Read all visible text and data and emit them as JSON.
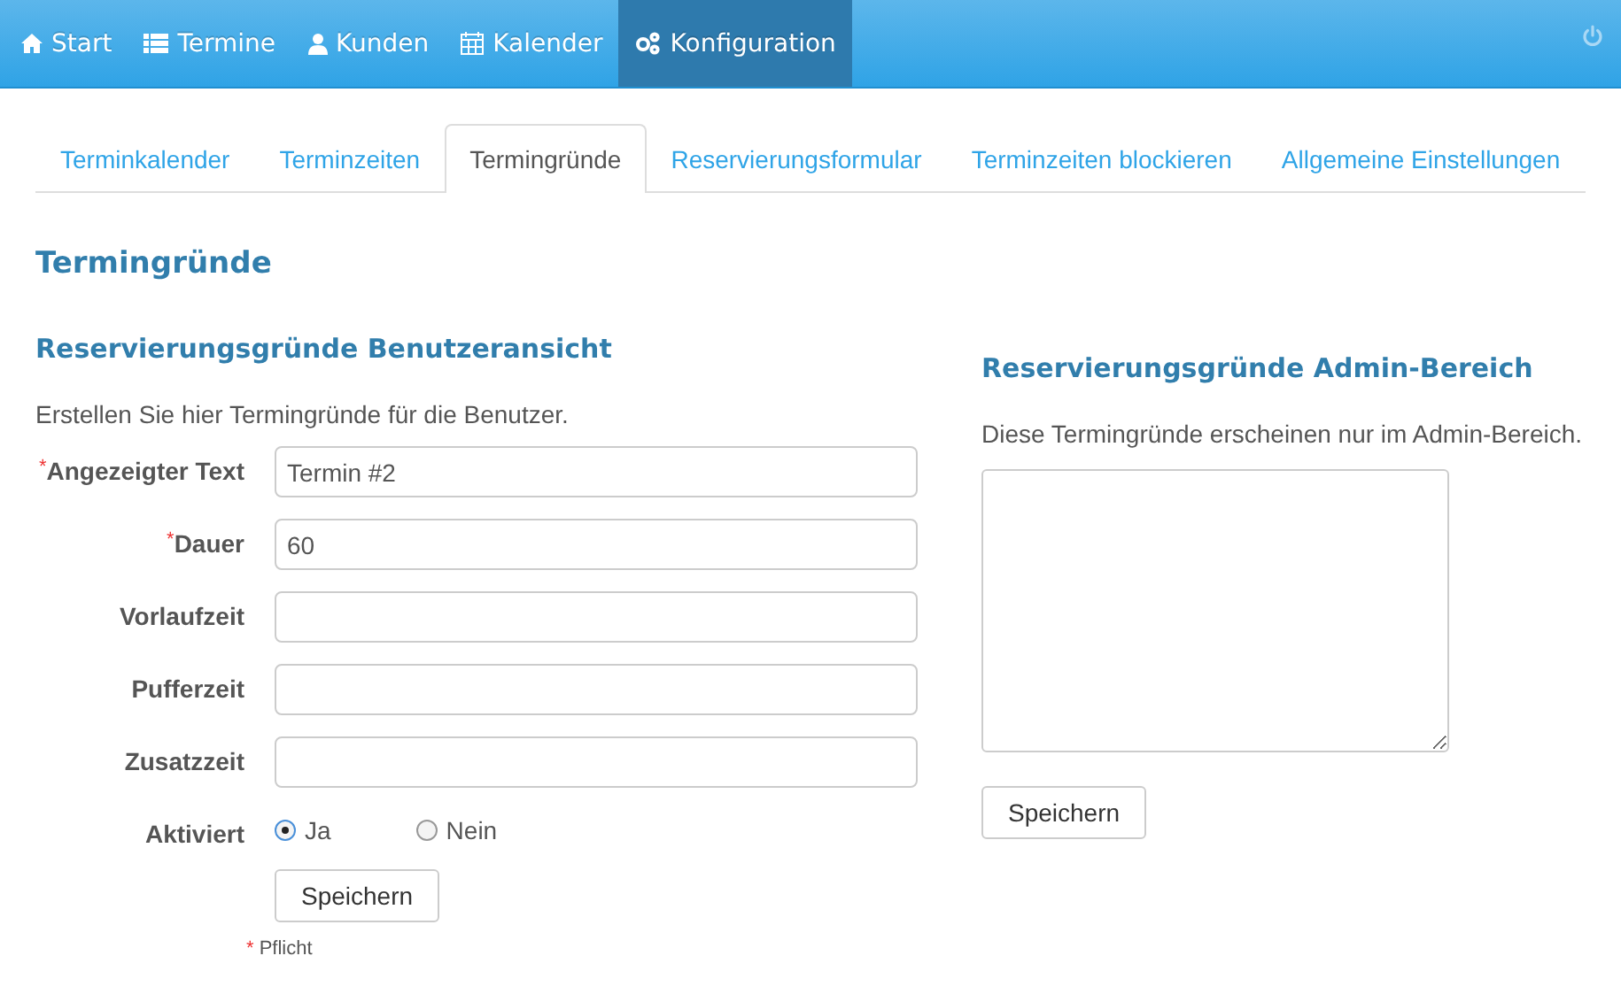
{
  "navbar": {
    "items": [
      {
        "label": "Start",
        "selected": false
      },
      {
        "label": "Termine",
        "selected": false
      },
      {
        "label": "Kunden",
        "selected": false
      },
      {
        "label": "Kalender",
        "selected": false
      },
      {
        "label": "Konfiguration",
        "selected": true
      }
    ]
  },
  "tabs": [
    {
      "label": "Terminkalender",
      "selected": false
    },
    {
      "label": "Terminzeiten",
      "selected": false
    },
    {
      "label": "Termingründe",
      "selected": true
    },
    {
      "label": "Reservierungsformular",
      "selected": false
    },
    {
      "label": "Terminzeiten blockieren",
      "selected": false
    },
    {
      "label": "Allgemeine Einstellungen",
      "selected": false
    }
  ],
  "page_title": "Termingründe",
  "user_section": {
    "title": "Reservierungsgründe Benutzeransicht",
    "description": "Erstellen Sie hier Termingründe für die Benutzer.",
    "fields": [
      {
        "kind": "text",
        "label": "Angezeigter Text",
        "required_mark": "*",
        "value": "Termin #2"
      },
      {
        "kind": "text",
        "label": "Dauer",
        "required_mark": "*",
        "value": "60"
      },
      {
        "kind": "text",
        "label": "Vorlaufzeit"
      },
      {
        "kind": "text",
        "label": "Pufferzeit"
      },
      {
        "kind": "text",
        "label": "Zusatzzeit"
      },
      {
        "kind": "radio",
        "label": "Aktiviert",
        "options": [
          {
            "label": "Ja",
            "selected": true
          },
          {
            "label": "Nein",
            "selected": false
          }
        ]
      }
    ],
    "save_button": "Speichern",
    "required_note": {
      "mark": "*",
      "text": "Pflicht"
    }
  },
  "admin_section": {
    "title": "Reservierungsgründe Admin-Bereich",
    "description": "Diese Termingründe erscheinen nur im Admin-Bereich.",
    "save_button": "Speichern"
  }
}
